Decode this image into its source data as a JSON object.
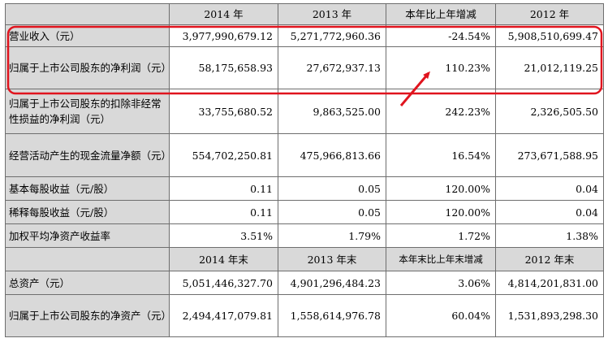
{
  "header1": {
    "corner": "",
    "y2014": "2014 年",
    "y2013": "2013 年",
    "change": "本年比上年增减",
    "y2012": "2012 年"
  },
  "rows1": [
    {
      "label": "营业收入（元）",
      "v2014": "3,977,990,679.12",
      "v2013": "5,271,772,960.36",
      "change": "-24.54%",
      "v2012": "5,908,510,699.47"
    },
    {
      "label": "归属于上市公司股东的净利润（元）",
      "v2014": "58,175,658.93",
      "v2013": "27,672,937.13",
      "change": "110.23%",
      "v2012": "21,012,119.25"
    },
    {
      "label": "归属于上市公司股东的扣除非经常性损益的净利润（元）",
      "v2014": "33,755,680.52",
      "v2013": "9,863,525.00",
      "change": "242.23%",
      "v2012": "2,326,505.50"
    },
    {
      "label": "经营活动产生的现金流量净额（元）",
      "v2014": "554,702,250.81",
      "v2013": "475,966,813.66",
      "change": "16.54%",
      "v2012": "273,671,588.95"
    },
    {
      "label": "基本每股收益（元/股）",
      "v2014": "0.11",
      "v2013": "0.05",
      "change": "120.00%",
      "v2012": "0.04"
    },
    {
      "label": "稀释每股收益（元/股）",
      "v2014": "0.11",
      "v2013": "0.05",
      "change": "120.00%",
      "v2012": "0.04"
    },
    {
      "label": "加权平均净资产收益率",
      "v2014": "3.51%",
      "v2013": "1.79%",
      "change": "1.72%",
      "v2012": "1.38%"
    }
  ],
  "header2": {
    "corner": "",
    "y2014": "2014 年末",
    "y2013": "2013 年末",
    "change": "本年末比上年末增减",
    "y2012": "2012 年末"
  },
  "rows2": [
    {
      "label": "总资产（元）",
      "v2014": "5,051,446,327.70",
      "v2013": "4,901,296,484.23",
      "change": "3.06%",
      "v2012": "4,814,201,831.00"
    },
    {
      "label": "归属于上市公司股东的净资产（元）",
      "v2014": "2,494,417,079.81",
      "v2013": "1,558,614,976.78",
      "change": "60.04%",
      "v2012": "1,531,893,298.30"
    }
  ],
  "annotation": {
    "highlight_color": "#e0141e",
    "arrow_color": "#e0141e"
  }
}
